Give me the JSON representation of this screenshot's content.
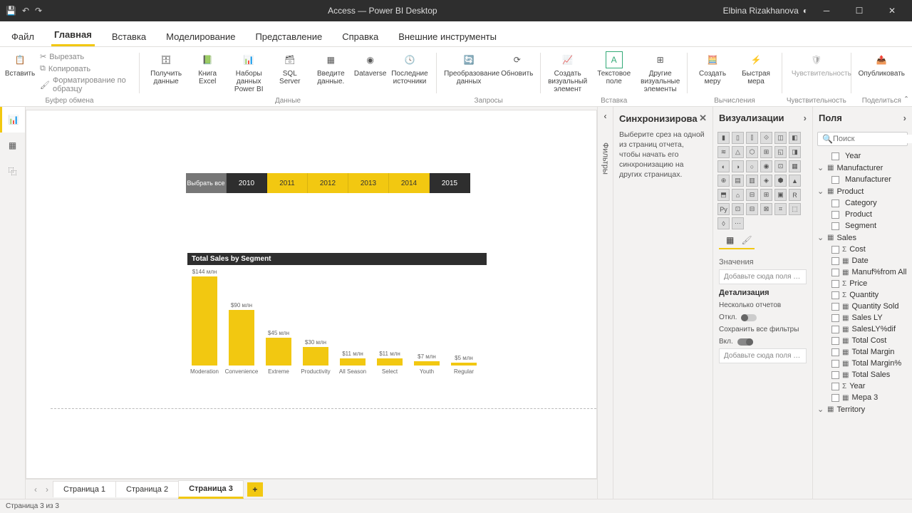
{
  "titlebar": {
    "title": "Access — Power BI Desktop",
    "user": "Elbina Rizakhanova"
  },
  "menu": {
    "file": "Файл",
    "items": [
      "Главная",
      "Вставка",
      "Моделирование",
      "Представление",
      "Справка",
      "Внешние инструменты"
    ],
    "active": 0
  },
  "ribbon": {
    "clipboard": {
      "paste": "Вставить",
      "cut": "Вырезать",
      "copy": "Копировать",
      "format": "Форматирование по образцу",
      "group": "Буфер обмена"
    },
    "data": {
      "get": "Получить данные",
      "excel": "Книга Excel",
      "pbi": "Наборы данных Power BI",
      "sql": "SQL Server",
      "enter": "Введите данные.",
      "dataverse": "Dataverse",
      "recent": "Последние источники",
      "group": "Данные"
    },
    "queries": {
      "transform": "Преобразование данных",
      "refresh": "Обновить",
      "group": "Запросы"
    },
    "insert": {
      "visual": "Создать визуальный элемент",
      "text": "Текстовое поле",
      "more": "Другие визуальные элементы",
      "group": "Вставка"
    },
    "calc": {
      "measure": "Создать меру",
      "quick": "Быстрая мера",
      "group": "Вычисления"
    },
    "sens": {
      "label": "Чувствительность",
      "group": "Чувствительность"
    },
    "share": {
      "publish": "Опубликовать",
      "group": "Поделиться"
    }
  },
  "slicer": {
    "all": "Выбрать все",
    "years": [
      "2010",
      "2011",
      "2012",
      "2013",
      "2014",
      "2015"
    ],
    "selected": [
      0,
      5
    ]
  },
  "chart_data": {
    "type": "bar",
    "title": "Total Sales by Segment",
    "categories": [
      "Moderation",
      "Convenience",
      "Extreme",
      "Productivity",
      "All Season",
      "Select",
      "Youth",
      "Regular"
    ],
    "values": [
      144,
      90,
      45,
      30,
      11,
      11,
      7,
      5
    ],
    "value_labels": [
      "$144 млн",
      "$90 млн",
      "$45 млн",
      "$30 млн",
      "$11 млн",
      "$11 млн",
      "$7 млн",
      "$5 млн"
    ],
    "ylim": [
      0,
      150
    ]
  },
  "pages": {
    "tabs": [
      "Страница 1",
      "Страница 2",
      "Страница 3"
    ],
    "active": 2
  },
  "filters_label": "Фильтры",
  "sync": {
    "title": "Синхронизирова",
    "body": "Выберите срез на одной из страниц отчета, чтобы начать его синхронизацию на других страницах."
  },
  "viz": {
    "title": "Визуализации",
    "values": "Значения",
    "add_fields": "Добавьте сюда поля с дан...",
    "drill": "Детализация",
    "cross": "Несколько отчетов",
    "off": "Откл.",
    "keep": "Сохранить все фильтры",
    "on": "Вкл.",
    "add_drill": "Добавьте сюда поля дета..."
  },
  "fields": {
    "title": "Поля",
    "search": "Поиск",
    "tree": [
      {
        "t": "child",
        "label": "Year",
        "icon": ""
      },
      {
        "t": "table",
        "label": "Manufacturer"
      },
      {
        "t": "child",
        "label": "Manufacturer",
        "icon": ""
      },
      {
        "t": "table",
        "label": "Product"
      },
      {
        "t": "child",
        "label": "Category",
        "icon": ""
      },
      {
        "t": "child",
        "label": "Product",
        "icon": ""
      },
      {
        "t": "child",
        "label": "Segment",
        "icon": ""
      },
      {
        "t": "table",
        "label": "Sales"
      },
      {
        "t": "child",
        "label": "Cost",
        "icon": "Σ"
      },
      {
        "t": "child",
        "label": "Date",
        "icon": "▦"
      },
      {
        "t": "child",
        "label": "Manuf%from All",
        "icon": "▦"
      },
      {
        "t": "child",
        "label": "Price",
        "icon": "Σ"
      },
      {
        "t": "child",
        "label": "Quantity",
        "icon": "Σ"
      },
      {
        "t": "child",
        "label": "Quantity Sold",
        "icon": "▦"
      },
      {
        "t": "child",
        "label": "Sales LY",
        "icon": "▦"
      },
      {
        "t": "child",
        "label": "SalesLY%dif",
        "icon": "▦"
      },
      {
        "t": "child",
        "label": "Total Cost",
        "icon": "▦"
      },
      {
        "t": "child",
        "label": "Total Margin",
        "icon": "▦"
      },
      {
        "t": "child",
        "label": "Total Margin%",
        "icon": "▦"
      },
      {
        "t": "child",
        "label": "Total Sales",
        "icon": "▦"
      },
      {
        "t": "child",
        "label": "Year",
        "icon": "Σ"
      },
      {
        "t": "child",
        "label": "Мера 3",
        "icon": "▦"
      },
      {
        "t": "table",
        "label": "Territory"
      }
    ]
  },
  "status": "Страница 3 из 3"
}
